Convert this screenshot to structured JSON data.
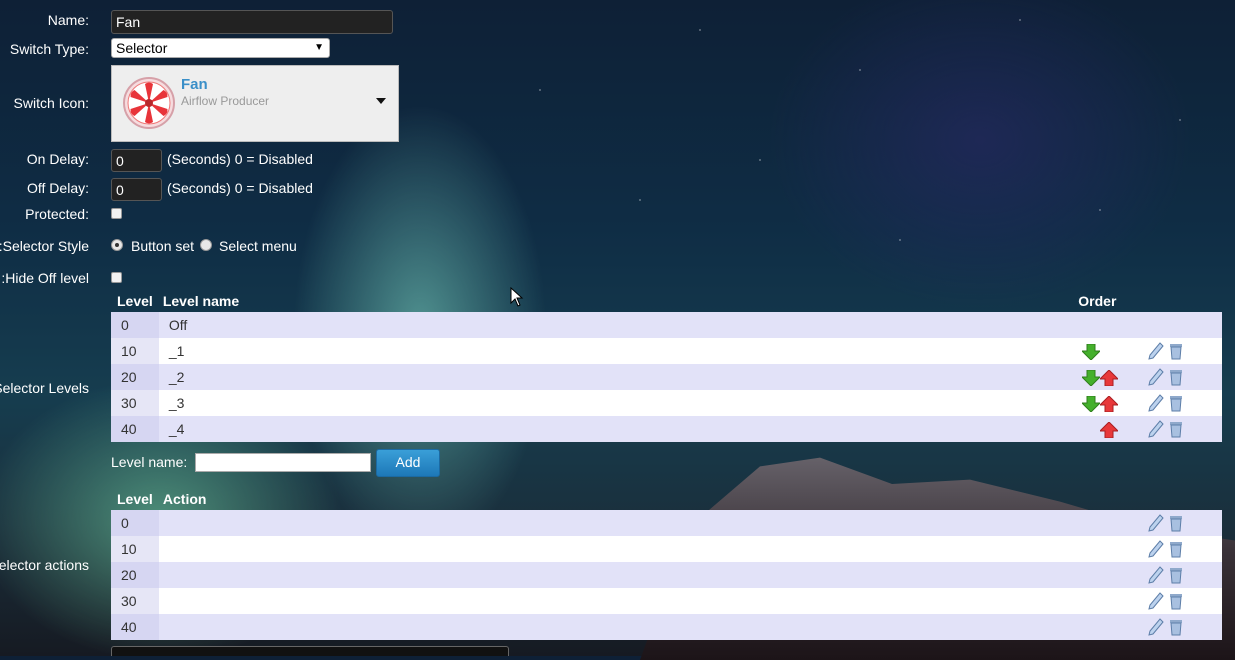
{
  "form": {
    "name_label": "Name:",
    "name_value": "Fan",
    "switch_type_label": "Switch Type:",
    "switch_type_value": "Selector",
    "switch_icon_label": "Switch Icon:",
    "icon_title": "Fan",
    "icon_subtitle": "Airflow Producer",
    "on_delay_label": "On Delay:",
    "on_delay_value": "0",
    "on_delay_hint": "(Seconds) 0 = Disabled",
    "off_delay_label": "Off Delay:",
    "off_delay_value": "0",
    "off_delay_hint": "(Seconds) 0 = Disabled",
    "protected_label": "Protected:",
    "selector_style_label": "Selector Style:",
    "style_option_1": "Button set",
    "style_option_2": "Select menu",
    "hide_off_label": "Hide Off level:"
  },
  "levels": {
    "section_label": "Selector Levels:",
    "col_level": "Level",
    "col_name": "Level name",
    "col_order": "Order",
    "rows": [
      {
        "level": "0",
        "name": "Off"
      },
      {
        "level": "10",
        "name": "_1"
      },
      {
        "level": "20",
        "name": "_2"
      },
      {
        "level": "30",
        "name": "_3"
      },
      {
        "level": "40",
        "name": "_4"
      }
    ],
    "add_label": "Level name:",
    "add_button": "Add"
  },
  "actions": {
    "section_label": "Selector actions:",
    "col_level": "Level",
    "col_action": "Action",
    "rows": [
      {
        "level": "0",
        "action": ""
      },
      {
        "level": "10",
        "action": ""
      },
      {
        "level": "20",
        "action": ""
      },
      {
        "level": "30",
        "action": ""
      },
      {
        "level": "40",
        "action": ""
      }
    ]
  },
  "icons": {
    "down": "arrow-down-icon",
    "up": "arrow-up-icon",
    "edit": "pencil-icon",
    "delete": "trash-icon",
    "fan": "fan-icon"
  },
  "colors": {
    "accent": "#1d78b8",
    "down_arrow": "#44b02c",
    "up_arrow": "#e8383a",
    "row_alt": "#e2e2f8"
  }
}
